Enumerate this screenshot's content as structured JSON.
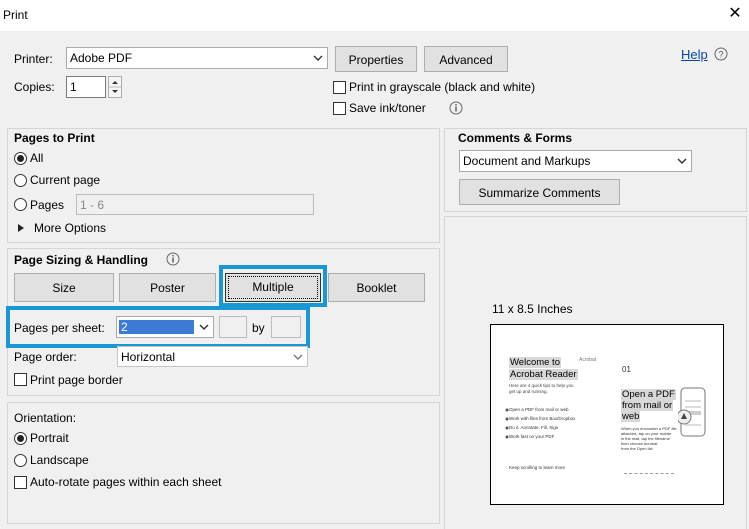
{
  "window": {
    "title": "Print",
    "close_glyph": "✕"
  },
  "printer": {
    "label": "Printer:",
    "value": "Adobe PDF",
    "properties_label": "Properties",
    "advanced_label": "Advanced",
    "help_label": "Help"
  },
  "copies": {
    "label": "Copies:",
    "value": "1"
  },
  "options": {
    "grayscale_label": "Print in grayscale (black and white)",
    "save_ink_label": "Save ink/toner"
  },
  "pages_to_print": {
    "title": "Pages to Print",
    "all_label": "All",
    "current_label": "Current page",
    "pages_label": "Pages",
    "pages_placeholder": "1 - 6",
    "more_options_label": "More Options",
    "selected": "All"
  },
  "sizing": {
    "title": "Page Sizing & Handling",
    "tabs": [
      "Size",
      "Poster",
      "Multiple",
      "Booklet"
    ],
    "active_tab": "Multiple",
    "pages_per_sheet_label": "Pages per sheet:",
    "pages_per_sheet_value": "2",
    "by_label": "by",
    "page_order_label": "Page order:",
    "page_order_value": "Horizontal",
    "print_border_label": "Print page border"
  },
  "orientation": {
    "title": "Orientation:",
    "portrait_label": "Portrait",
    "landscape_label": "Landscape",
    "auto_rotate_label": "Auto-rotate pages within each sheet",
    "selected": "Portrait"
  },
  "comments": {
    "title": "Comments & Forms",
    "value": "Document and Markups",
    "summarize_label": "Summarize Comments"
  },
  "preview": {
    "size_label": "11 x 8.5 Inches",
    "left_page": {
      "heading1": "Welcome to",
      "heading2": "Acrobat Reader",
      "line1": "Here are 4 quick tips to help you",
      "line2": "get up and running.",
      "tip1": "Open a PDF from mail or web",
      "tip2": "Work with files from Box/Dropbox",
      "tip3": "Do it. Annotate. Fill, Sign",
      "tip4": "Work fast on your PDF",
      "footer": "Keep scrolling to learn more",
      "logo_text": "Acrobat"
    },
    "right_page": {
      "number": "01",
      "heading1": "Open a PDF",
      "heading2": "from mail or",
      "heading3": "web",
      "body1": "When you encounter a PDF file",
      "body2": "attached, tap on your mobile",
      "body3": "in the mail, tap the filename",
      "body4": "then choose Acrobat",
      "body5": "from the Open list"
    }
  },
  "colors": {
    "highlight": "#1a98d5",
    "selection": "#3b7bd6",
    "link": "#0645ad"
  }
}
